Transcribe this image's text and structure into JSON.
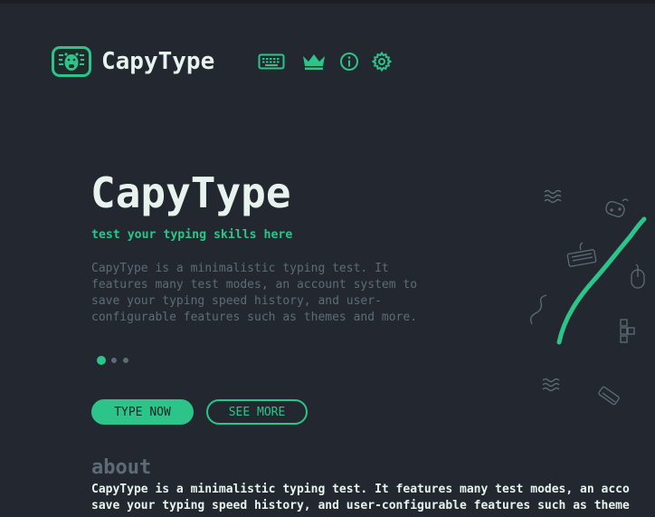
{
  "header": {
    "brand": "CapyType",
    "logo_icon": "capybara-logo-icon",
    "nav": [
      {
        "name": "keyboard-icon",
        "label": "type"
      },
      {
        "name": "crown-icon",
        "label": "leaderboard"
      },
      {
        "name": "info-icon",
        "label": "about"
      },
      {
        "name": "gear-icon",
        "label": "settings"
      }
    ]
  },
  "hero": {
    "title": "CapyType",
    "subtitle": "test your typing skills here",
    "description": "CapyType is a minimalistic typing test. It features many test modes, an account system to save your typing speed history, and user-configurable features such as themes and more.",
    "carousel": {
      "slides": 3,
      "active": 1
    }
  },
  "buttons": {
    "type_now": "TYPE NOW",
    "see_more": "SEE MORE"
  },
  "about": {
    "heading": "about",
    "text": "CapyType is a minimalistic typing test. It features many test modes, an acco\nsave your typing speed history, and user-configurable features such as theme"
  },
  "colors": {
    "background": "#232830",
    "accent": "#2cc489",
    "text": "#e9f3ee",
    "muted": "#5e6b76"
  }
}
